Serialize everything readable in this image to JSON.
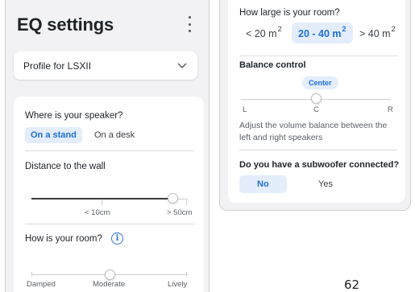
{
  "left_screen": {
    "title": "EQ settings",
    "profile_label": "Profile for LSXII",
    "speaker_question": "Where is your speaker?",
    "speaker_options": [
      "On a stand",
      "On a desk"
    ],
    "speaker_selected": "On a stand",
    "distance_label": "Distance to the wall",
    "distance_min_label": "< 10cm",
    "distance_max_label": "> 50cm",
    "distance_level": 0.9,
    "room_question": "How is your room?",
    "room_labels": [
      "Damped",
      "Moderate",
      "Lively"
    ],
    "room_selected": "Moderate"
  },
  "right_screen": {
    "size_question": "How large is your room?",
    "size_options": [
      {
        "label": "< 20 m",
        "sup": "2",
        "selected": false
      },
      {
        "label": "20 - 40 m",
        "sup": "2",
        "selected": true
      },
      {
        "label": "> 40 m",
        "sup": "2",
        "selected": false
      }
    ],
    "balance_label": "Balance control",
    "balance_value": "Center",
    "balance_left": "L",
    "balance_center": "C",
    "balance_right": "R",
    "balance_desc": "Adjust the volume balance between the left and right speakers",
    "subwoofer_question": "Do you have a subwoofer connected?",
    "subwoofer_options": [
      "No",
      "Yes"
    ],
    "subwoofer_selected": "No"
  },
  "page_number": "62",
  "colors": {
    "accent": "#1f6fd6",
    "chip_bg": "#e3edfb",
    "screen_bg": "#f2f2f4"
  }
}
